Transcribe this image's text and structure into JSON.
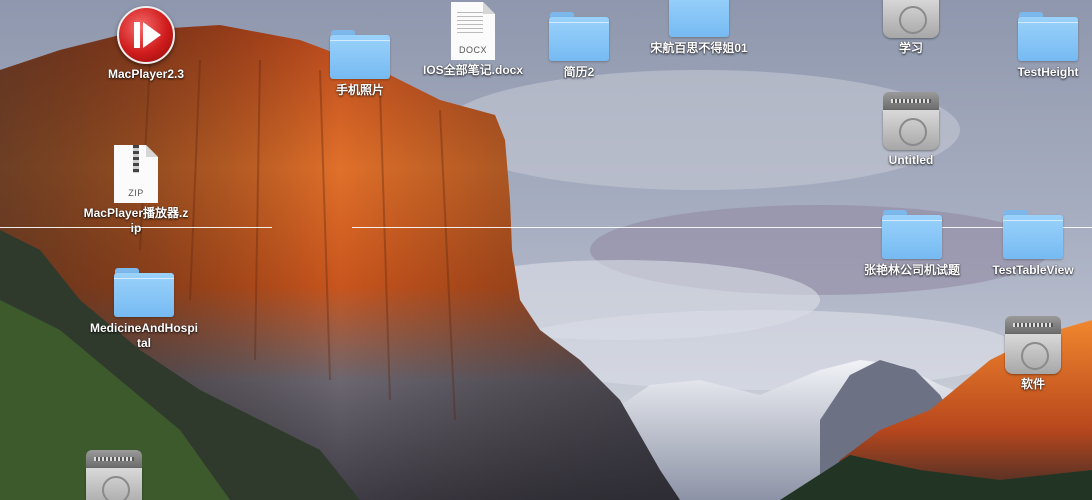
{
  "desktop": {
    "icons": [
      {
        "label": "MacPlayer2.3",
        "icon": "red-play-app-icon"
      },
      {
        "label": "MacPlayer播放器.zip",
        "icon": "zip-file-icon",
        "badge": "ZIP"
      },
      {
        "label": "MedicineAndHospital",
        "icon": "folder-icon"
      },
      {
        "label": "手机照片",
        "icon": "folder-icon"
      },
      {
        "label": "IOS全部笔记.docx",
        "icon": "docx-file-icon",
        "badge": "DOCX"
      },
      {
        "label": "简历2",
        "icon": "folder-icon"
      },
      {
        "label": "宋航百思不得姐01",
        "icon": "folder-icon"
      },
      {
        "label": "学习",
        "icon": "hard-disk-icon"
      },
      {
        "label": "TestHeight",
        "icon": "folder-icon"
      },
      {
        "label": "Untitled",
        "icon": "hard-disk-icon"
      },
      {
        "label": "张艳林公司机试题",
        "icon": "folder-icon"
      },
      {
        "label": "TestTableView",
        "icon": "folder-icon"
      },
      {
        "label": "软件",
        "icon": "hard-disk-icon"
      },
      {
        "label": "",
        "icon": "hard-disk-icon"
      }
    ]
  },
  "colors": {
    "folder_blue": "#86c5f7",
    "player_red": "#d01c1c",
    "cliff_orange": "#e0702a"
  }
}
